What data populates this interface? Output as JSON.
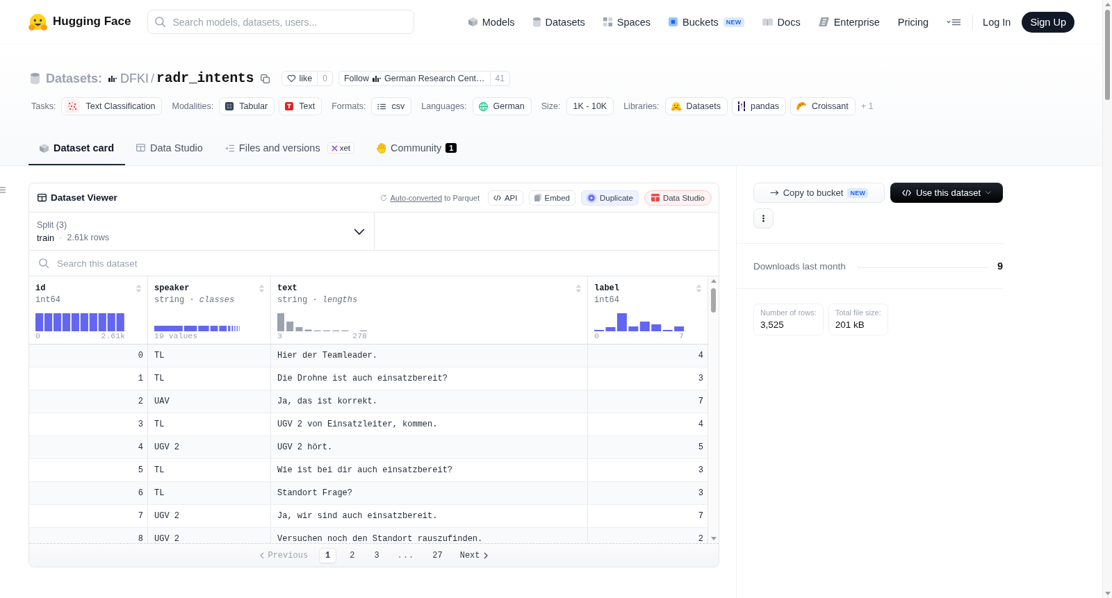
{
  "header": {
    "brand": "Hugging Face",
    "search": {
      "placeholder": "Search models, datasets, users..."
    },
    "nav": [
      {
        "kind": "models",
        "label": "Models"
      },
      {
        "kind": "datasets",
        "label": "Datasets"
      },
      {
        "kind": "spaces",
        "label": "Spaces"
      },
      {
        "kind": "buckets",
        "label": "Buckets",
        "badge": "NEW"
      },
      {
        "kind": "docs",
        "label": "Docs"
      },
      {
        "kind": "enterprise",
        "label": "Enterprise"
      },
      {
        "kind": "pricing",
        "label": "Pricing"
      }
    ],
    "login": "Log In",
    "signup": "Sign Up"
  },
  "dataset": {
    "section": "Datasets:",
    "owner": "DFKI",
    "separator": "/",
    "name": "radr_intents",
    "like": {
      "label": "like",
      "count": "0"
    },
    "follow": {
      "label": "Follow",
      "org": "German Research Cent…",
      "count": "41"
    }
  },
  "tag_groups": [
    {
      "label": "Tasks:",
      "chips": [
        {
          "kind": "task",
          "text": "Text Classification"
        }
      ]
    },
    {
      "label": "Modalities:",
      "chips": [
        {
          "kind": "tabular",
          "text": "Tabular"
        },
        {
          "kind": "text",
          "text": "Text"
        }
      ]
    },
    {
      "label": "Formats:",
      "chips": [
        {
          "kind": "csv",
          "text": "csv"
        }
      ]
    },
    {
      "label": "Languages:",
      "chips": [
        {
          "kind": "language",
          "text": "German"
        }
      ]
    },
    {
      "label": "Size:",
      "chips": [
        {
          "kind": "plain",
          "text": "1K - 10K"
        }
      ]
    },
    {
      "label": "Libraries:",
      "chips": [
        {
          "kind": "datasets",
          "text": "Datasets"
        },
        {
          "kind": "pandas",
          "text": "pandas"
        },
        {
          "kind": "croissant",
          "text": "Croissant"
        }
      ],
      "more": "+ 1"
    }
  ],
  "tabs": [
    {
      "kind": "card",
      "label": "Dataset card",
      "selected": true
    },
    {
      "kind": "studio",
      "label": "Data Studio",
      "selected": false
    },
    {
      "kind": "files",
      "label": "Files and versions",
      "selected": false,
      "badge": "xet"
    },
    {
      "kind": "community",
      "label": "Community",
      "selected": false,
      "count": "1"
    }
  ],
  "viewer": {
    "title": "Dataset Viewer",
    "note": {
      "link": "Auto-converted",
      "rest": "to Parquet"
    },
    "actions": [
      {
        "kind": "api",
        "label": "API"
      },
      {
        "kind": "embed",
        "label": "Embed"
      },
      {
        "kind": "duplicate",
        "label": "Duplicate"
      },
      {
        "kind": "studio",
        "label": "Data Studio"
      }
    ],
    "split": {
      "label": "Split (3)",
      "value": "train",
      "separator": "·",
      "rows": "2.61k rows"
    },
    "search": {
      "placeholder": "Search this dataset"
    },
    "columns": [
      {
        "name": "id",
        "type": "int64",
        "kind": "histogram",
        "range": [
          "0",
          "2.61k"
        ]
      },
      {
        "name": "speaker",
        "type": "string · *classes*",
        "kind": "classes",
        "summary": "19 values"
      },
      {
        "name": "text",
        "type": "string · *lengths*",
        "kind": "lengths",
        "range": [
          "3",
          "278"
        ]
      },
      {
        "name": "label",
        "type": "int64",
        "kind": "histogram",
        "range": [
          "0",
          "7"
        ]
      }
    ],
    "rows": [
      [
        "0",
        "TL",
        "Hier der Teamleader.",
        "4"
      ],
      [
        "1",
        "TL",
        "Die Drohne ist auch einsatzbereit?",
        "3"
      ],
      [
        "2",
        "UAV",
        "Ja, das ist korrekt.",
        "7"
      ],
      [
        "3",
        "TL",
        "UGV 2 von Einsatzleiter, kommen.",
        "4"
      ],
      [
        "4",
        "UGV 2",
        "UGV 2 hört.",
        "5"
      ],
      [
        "5",
        "TL",
        "Wie ist bei dir auch einsatzbereit?",
        "3"
      ],
      [
        "6",
        "TL",
        "Standort Frage?",
        "3"
      ],
      [
        "7",
        "UGV 2",
        "Ja, wir sind auch einsatzbereit.",
        "7"
      ],
      [
        "8",
        "UGV 2",
        "Versuchen noch den Standort rauszufinden.",
        "2"
      ]
    ],
    "pagination": {
      "previous": {
        "label": "Previous",
        "disabled": true
      },
      "pages": [
        {
          "kind": "page",
          "label": "1",
          "selected": true
        },
        {
          "kind": "page",
          "label": "2",
          "selected": false
        },
        {
          "kind": "page",
          "label": "3",
          "selected": false
        },
        {
          "kind": "ellipsis",
          "label": "...",
          "selected": false
        },
        {
          "kind": "page",
          "label": "27",
          "selected": false
        }
      ],
      "next": {
        "label": "Next",
        "disabled": false
      }
    }
  },
  "sidebar": {
    "copy_button": {
      "label": "Copy to bucket",
      "badge": "NEW"
    },
    "use_button": {
      "label": "Use this dataset"
    },
    "downloads": {
      "label": "Downloads last month",
      "value": "9"
    },
    "stats": [
      {
        "label": "Number of rows:",
        "value": "3,525"
      },
      {
        "label": "Total file size:",
        "value": "201 kB"
      }
    ]
  }
}
